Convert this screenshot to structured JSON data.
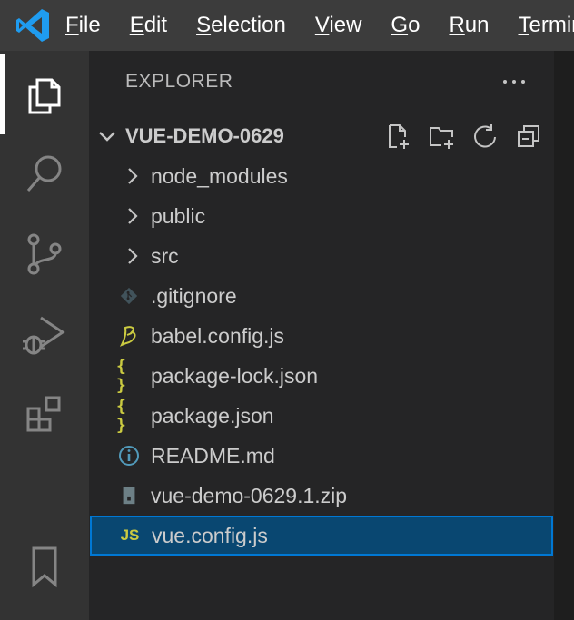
{
  "menu": {
    "items": [
      "File",
      "Edit",
      "Selection",
      "View",
      "Go",
      "Run",
      "Terminal"
    ]
  },
  "activity_bar": {
    "icons": [
      "explorer-icon",
      "search-icon",
      "source-control-icon",
      "run-debug-icon",
      "extensions-icon",
      "bookmarks-icon"
    ],
    "active": "explorer-icon"
  },
  "sidebar": {
    "title": "EXPLORER",
    "folder": {
      "name": "VUE-DEMO-0629",
      "actions": [
        "new-file-icon",
        "new-folder-icon",
        "refresh-icon",
        "collapse-all-icon"
      ]
    },
    "items": [
      {
        "label": "node_modules",
        "kind": "folder",
        "icon": "chevron-right-icon"
      },
      {
        "label": "public",
        "kind": "folder",
        "icon": "chevron-right-icon"
      },
      {
        "label": "src",
        "kind": "folder",
        "icon": "chevron-right-icon"
      },
      {
        "label": ".gitignore",
        "kind": "file",
        "icon": "git-icon"
      },
      {
        "label": "babel.config.js",
        "kind": "file",
        "icon": "babel-icon"
      },
      {
        "label": "package-lock.json",
        "kind": "file",
        "icon": "json-icon",
        "glyph": "{ }"
      },
      {
        "label": "package.json",
        "kind": "file",
        "icon": "json-icon",
        "glyph": "{ }"
      },
      {
        "label": "README.md",
        "kind": "file",
        "icon": "info-icon"
      },
      {
        "label": "vue-demo-0629.1.zip",
        "kind": "file",
        "icon": "zip-icon"
      },
      {
        "label": "vue.config.js",
        "kind": "file",
        "icon": "js-icon",
        "glyph": "JS",
        "selected": true
      }
    ]
  },
  "colors": {
    "menubar": "#3c3c3c",
    "activitybar": "#333333",
    "sidebar": "#252526",
    "selection": "#094771",
    "focus_border": "#0078d4",
    "json_icon": "#cbcb41",
    "js_icon": "#cbcb41",
    "info_icon": "#519aba"
  }
}
